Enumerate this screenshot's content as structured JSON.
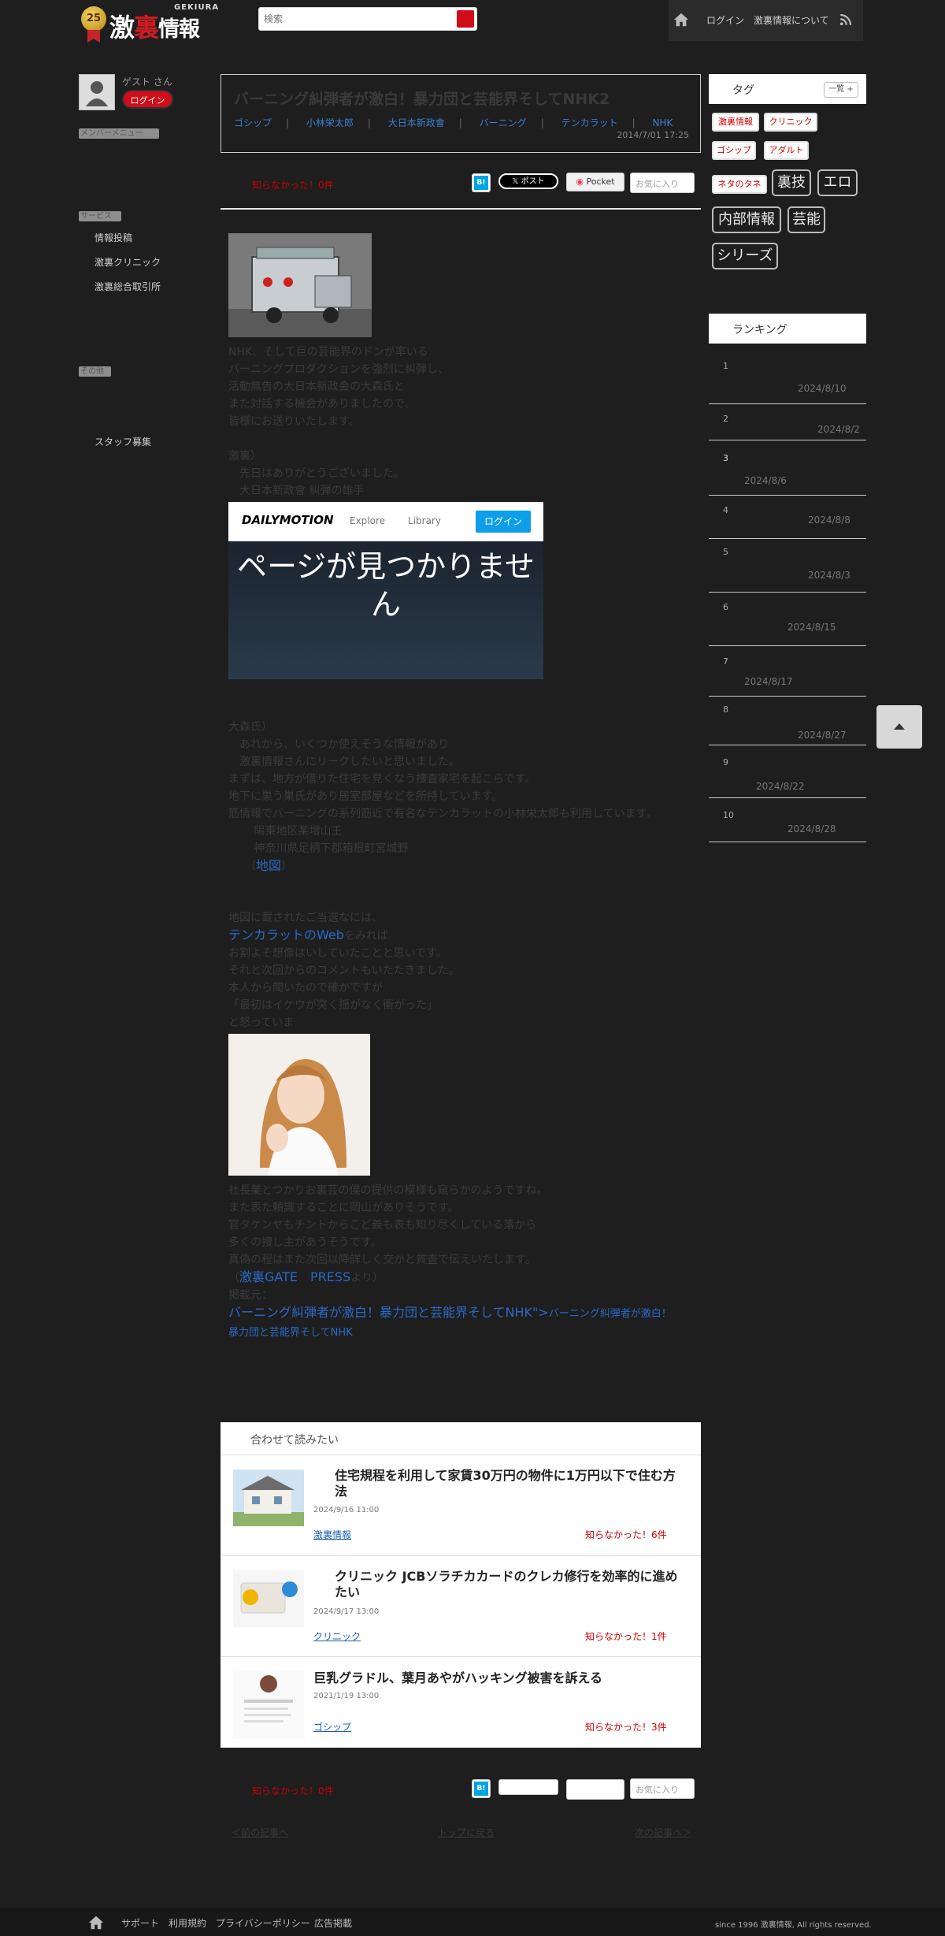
{
  "header": {
    "logo_badge": "25",
    "logo_text_a": "激",
    "logo_text_b": "裏",
    "logo_text_c": "情報",
    "logo_roman": "GEKIURA",
    "search_placeholder": "検索",
    "nav": {
      "login": "ログイン",
      "about": "激裏情報について"
    }
  },
  "left_sidebar": {
    "guest_label": "ゲスト さん",
    "login_button": "ログイン",
    "section1_header": "メンバーメニュー",
    "section2_header": "サービス",
    "links": [
      "情報投稿",
      "激裏クリニック",
      "激裏総合取引所"
    ],
    "section3_header": "その他",
    "staff_link": "スタッフ募集"
  },
  "article": {
    "title": "バーニング糾弾者が激白！暴力団と芸能界そしてNHK2",
    "tags": [
      "ゴシップ",
      "小林栄太郎",
      "大日本新政會",
      "バーニング",
      "テンカラット",
      "NHK"
    ],
    "tag_sep": "|",
    "date": "2014/7/01 17:25",
    "shiranakatta_top": "知らなかった！0件",
    "shiranakatta_bottom": "知らなかった！0件",
    "share": {
      "hatena": "B!",
      "post": "𝕏 ポスト",
      "pocket": "Pocket",
      "favorite": "お気に入り"
    },
    "para1": [
      "NHK、そして巨の芸能界のドンが率いる",
      "バーニングプロダクションを強烈に糾弾し、",
      "活動無告の大日本新政会の大森氏と",
      "また対話する機会がありましたので、",
      "皆様にお送りいたします。"
    ],
    "para2": [
      "激裏）",
      "　先日はありがとうございました。",
      "　大日本新政會 糾弾の雄手"
    ],
    "video": {
      "logo": "DAILYMOTION",
      "explore": "Explore",
      "library": "Library",
      "login": "ログイン",
      "message": "ページが見つかりません"
    },
    "para3": [
      "大森氏）",
      "　あれから、いくつか使えそうな情報があり",
      "　激裏情報さんにリークしたいと思いました。",
      "まずは、地方が借りた住宅を見くなう捜査家宅を起こらです。",
      "地下に巣う巣氏があり居室部屋などを所持しています。",
      "筋情報でバーニングの系列筋近で有名なテンカラットの小林栄太郎も利用しています。",
      "　　 陽東地区某増山王",
      "　　 神奈川県足柄下郡箱根町宮城野",
      "　　（"
    ],
    "map_link": "地図",
    "map_close": "）",
    "para4_a": "地図に載されたご当選なには、",
    "tenkarat_link": "テンカラットのWeb",
    "para4_b": "をみれば",
    "para4": [
      "お割よそ想像はいしていたことと思いです。",
      "それと次回からのコメントもいたたきました。",
      "本人から聞いたので確かですが",
      "「最初はイケウが突く揺がなく衝がった」",
      "と怒っていま"
    ],
    "para5": [
      "社長業とつかりお裏芸の僕の提供の模様も窺らかのようですね。",
      "また表た頼識することに岡山がありそうです。",
      "官タケンヤもチントからこど義も表も知り尽くしている落から",
      "多くの捜し主があうそうです。",
      "真偽の程はまた次回以降詳しく交かと質査で伝えいたします。",
      "（"
    ],
    "gate_link": "激裏GATE　PRESS",
    "para5_end": "より）",
    "reprint": "掲載元：",
    "link_title": "バーニング糾弾者が激白！暴力団と芸能界そしてNHK\">",
    "link_tail": "バーニング糾弾者が激白！暴力団と芸能界そしてNHK"
  },
  "related": {
    "header": "合わせて読みたい",
    "items": [
      {
        "title": "住宅規程を利用して家賃30万円の物件に1万円以下で住む方法",
        "date": "2024/9/16 11:00",
        "category": "激裏情報",
        "count": "知らなかった！6件"
      },
      {
        "title": "クリニック JCBソラチカカードのクレカ修行を効率的に進めたい",
        "date": "2024/9/17 13:00",
        "category": "クリニック",
        "count": "知らなかった！1件"
      },
      {
        "title": "巨乳グラドル、葉月あやがハッキング被害を訴える",
        "date": "2021/1/19 13:00",
        "category": "ゴシップ",
        "count": "知らなかった！3件"
      }
    ]
  },
  "bottom_nav": {
    "prev": "＜前の記事へ",
    "top": "トップに戻る",
    "next": "次の記事へ＞"
  },
  "right_sidebar": {
    "tags_header": "タグ",
    "tags_all": "一覧 +",
    "small_tags": [
      "激裏情報",
      "クリニック",
      "ゴシップ",
      "アダルト",
      "ネタのタネ"
    ],
    "big_tags": [
      "裏技",
      "エロ",
      "内部情報",
      "芸能",
      "シリーズ"
    ],
    "ranking_header": "ランキング",
    "ranking": [
      {
        "num": "1",
        "date": "2024/8/10"
      },
      {
        "num": "2",
        "date": "2024/8/2"
      },
      {
        "num": "3",
        "date": "2024/8/6"
      },
      {
        "num": "4",
        "date": "2024/8/8"
      },
      {
        "num": "5",
        "date": "2024/8/3"
      },
      {
        "num": "6",
        "date": "2024/8/15"
      },
      {
        "num": "7",
        "date": "2024/8/17"
      },
      {
        "num": "8",
        "date": "2024/8/27"
      },
      {
        "num": "9",
        "date": "2024/8/22"
      },
      {
        "num": "10",
        "date": "2024/8/28"
      }
    ]
  },
  "footer": {
    "links": [
      "サポート",
      "利用規約",
      "プライバシーポリシー",
      "広告掲載"
    ],
    "copyright": "since 1996 激裏情報, All rights reserved."
  }
}
